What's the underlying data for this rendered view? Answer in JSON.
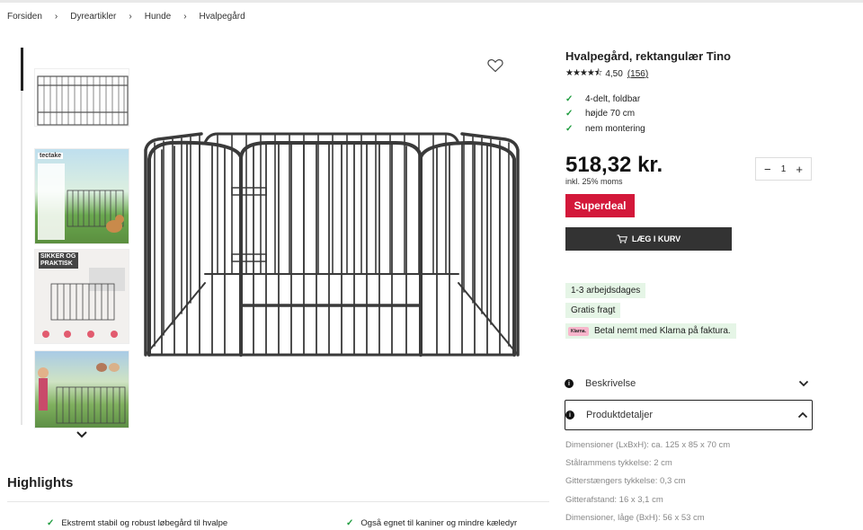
{
  "breadcrumb": [
    "Forsiden",
    "Dyreartikler",
    "Hunde",
    "Hvalpegård"
  ],
  "breadcrumb_separator": "›",
  "thumbnails": [
    {
      "label": "",
      "icon": "playpen-photo"
    },
    {
      "label": "tectake",
      "icon": "playpen-lifestyle-photo"
    },
    {
      "label": "SIKKER OG PRAKTISK",
      "icon": "playpen-feature-photo"
    },
    {
      "label": "",
      "icon": "playpen-garden-photo"
    }
  ],
  "product": {
    "title": "Hvalpegård, rektangulær Tino",
    "stars": "★★★★⯪",
    "rating": "4,50",
    "review_count": "(156)",
    "features": [
      "4-delt, foldbar",
      "højde 70 cm",
      "nem montering"
    ],
    "price": "518,32 kr.",
    "vat_note": "inkl. 25% moms",
    "quantity": "1",
    "badge": "Superdeal",
    "add_to_cart": "LÆG I KURV"
  },
  "delivery": {
    "shipping_time": "1-3 arbejdsdages",
    "free_shipping": "Gratis fragt",
    "klarna_logo": "Klarna.",
    "klarna_text": "Betal nemt med Klarna på faktura."
  },
  "accordion": {
    "description": "Beskrivelse",
    "details": "Produktdetaljer"
  },
  "specs": [
    "Dimensioner (LxBxH): ca. 125 x 85 x 70 cm",
    "Stålrammens tykkelse: 2 cm",
    "Gitterstængers tykkelse: 0,3 cm",
    "Gitterafstand: 16 x 3,1 cm",
    "Dimensioner, låge (BxH): 56 x 53 cm"
  ],
  "highlights": {
    "title": "Highlights",
    "items": [
      "Ekstremt stabil og robust løbegård til hvalpe",
      "Også egnet til kaniner og mindre kæledyr"
    ]
  },
  "colors": {
    "accent_red": "#d3183a",
    "cart_button": "#333333",
    "check_green": "#1e9c3e",
    "pill_green": "#e5f5e6",
    "klarna_pink": "#f8b5cb"
  }
}
